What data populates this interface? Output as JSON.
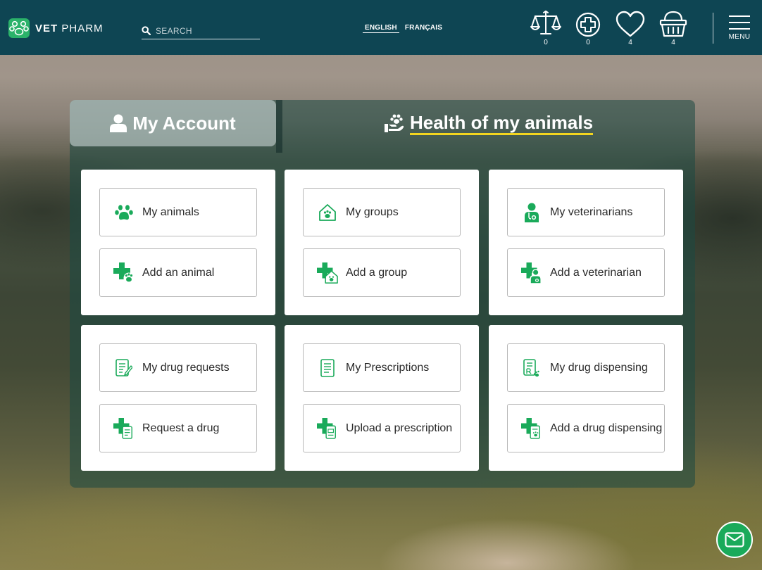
{
  "header": {
    "brand_bold": "VET",
    "brand_light": "PHARM",
    "search_placeholder": "SEARCH",
    "languages": [
      "ENGLISH",
      "FRANÇAIS"
    ],
    "active_language": "ENGLISH",
    "icons": [
      {
        "name": "compare-scale-icon",
        "count": "0"
      },
      {
        "name": "medical-cross-icon",
        "count": "0"
      },
      {
        "name": "favorites-heart-icon",
        "count": "4"
      },
      {
        "name": "cart-basket-icon",
        "count": "4"
      }
    ],
    "menu_label": "MENU"
  },
  "tabs": {
    "account": "My Account",
    "health": "Health of my animals",
    "active": "health"
  },
  "cards": [
    {
      "top": {
        "label": "My animals",
        "icon": "paw-icon"
      },
      "bottom": {
        "label": "Add an animal",
        "icon": "add-animal-icon"
      }
    },
    {
      "top": {
        "label": "My groups",
        "icon": "group-house-paw-icon"
      },
      "bottom": {
        "label": "Add a group",
        "icon": "add-group-icon"
      }
    },
    {
      "top": {
        "label": "My veterinarians",
        "icon": "veterinarian-icon"
      },
      "bottom": {
        "label": "Add a veterinarian",
        "icon": "add-veterinarian-icon"
      }
    },
    {
      "top": {
        "label": "My drug requests",
        "icon": "drug-request-form-icon"
      },
      "bottom": {
        "label": "Request a drug",
        "icon": "add-drug-request-icon"
      }
    },
    {
      "top": {
        "label": "My Prescriptions",
        "icon": "prescription-document-icon"
      },
      "bottom": {
        "label": "Upload a prescription",
        "icon": "add-prescription-icon"
      }
    },
    {
      "top": {
        "label": "My drug dispensing",
        "icon": "drug-dispensing-icon"
      },
      "bottom": {
        "label": "Add a drug dispensing",
        "icon": "add-drug-dispensing-icon"
      }
    }
  ],
  "colors": {
    "header_bg": "#0e4553",
    "accent_green": "#1aaa5a",
    "active_tab_underline": "#f2d51f"
  }
}
